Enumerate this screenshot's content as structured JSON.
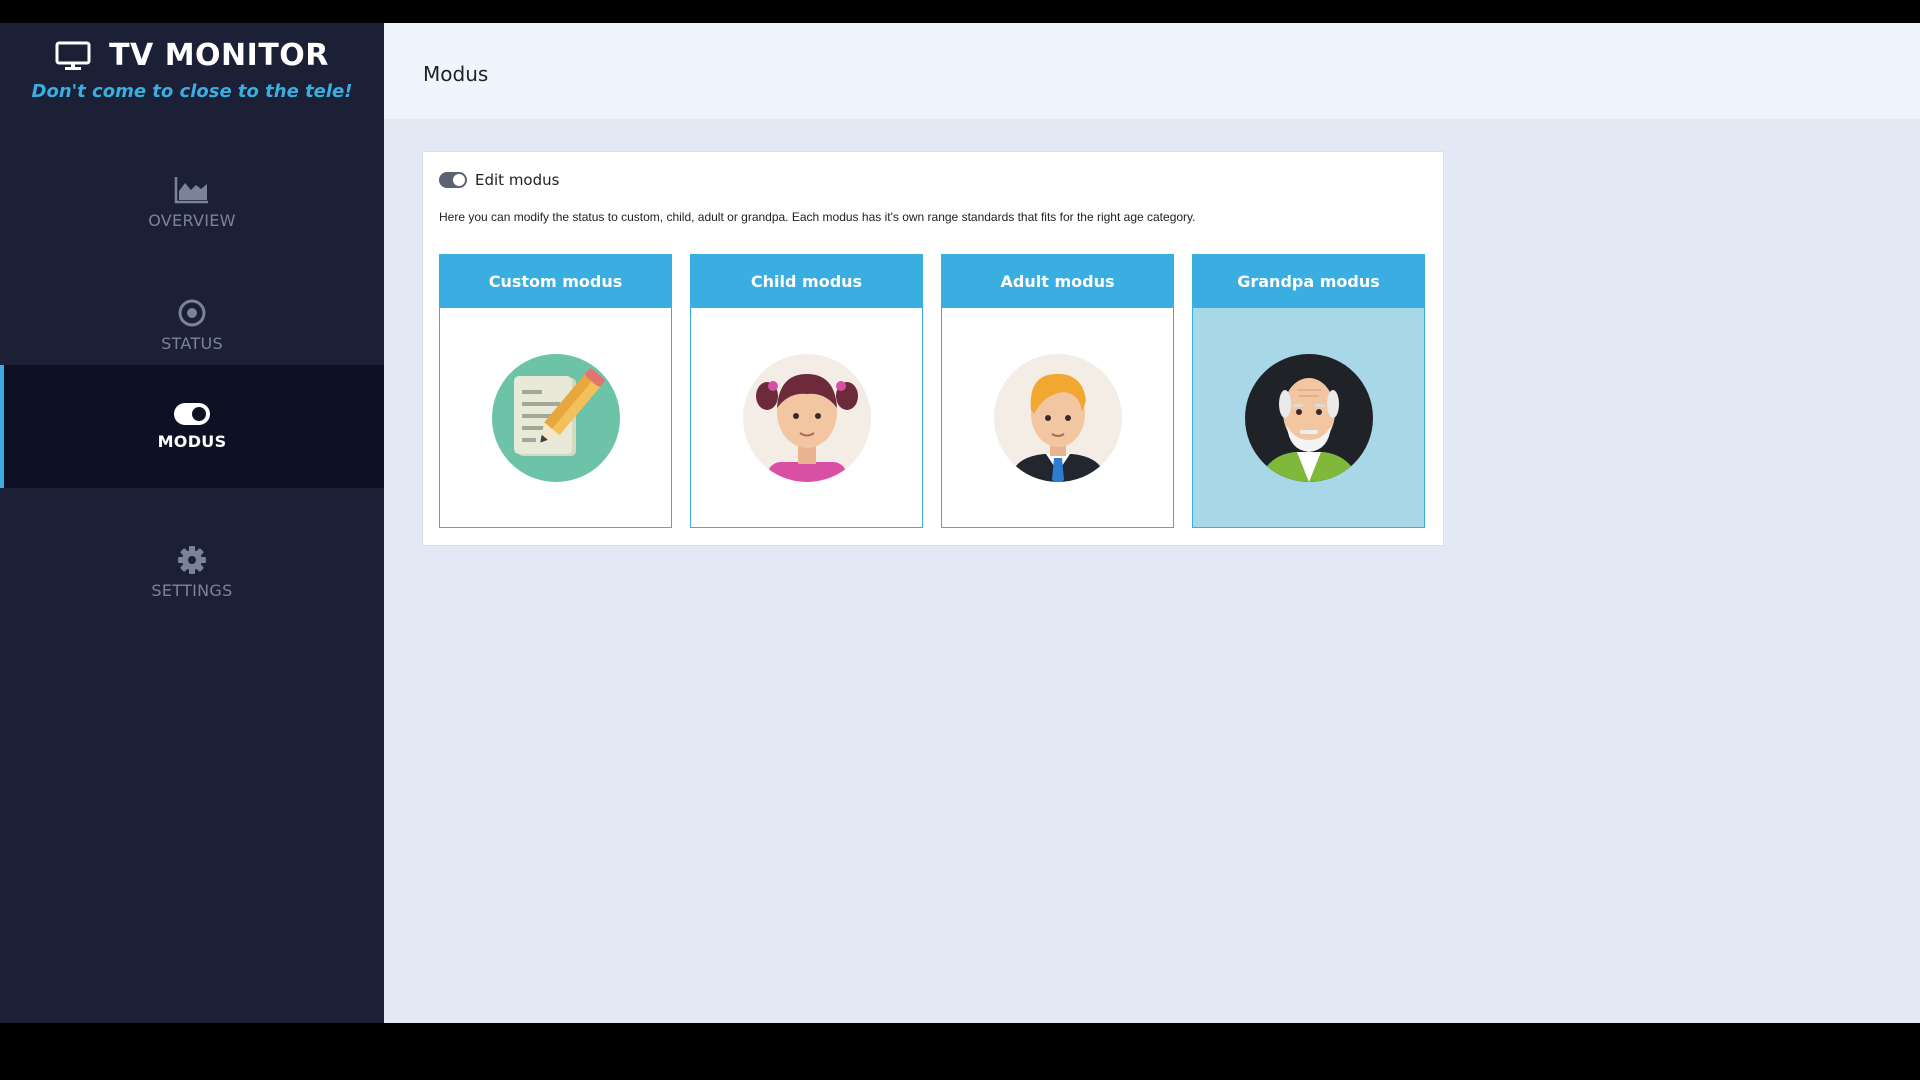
{
  "brand": {
    "title": "TV MONITOR",
    "tagline": "Don't come to close to the tele!",
    "icon": "tv-monitor-icon"
  },
  "nav": {
    "items": [
      {
        "label": "OVERVIEW",
        "icon": "area-chart-icon",
        "active": false
      },
      {
        "label": "STATUS",
        "icon": "target-icon",
        "active": false
      },
      {
        "label": "MODUS",
        "icon": "toggle-icon",
        "active": true
      },
      {
        "label": "SETTINGS",
        "icon": "gear-icon",
        "active": false
      }
    ]
  },
  "header": {
    "title": "Modus"
  },
  "panel": {
    "toggle_label": "Edit modus",
    "toggle_on": true,
    "description": "Here you can modify the status to custom, child, adult or grandpa. Each modus has it's own range standards that fits for the right age category.",
    "cards": [
      {
        "title": "Custom modus",
        "avatar": "notepad-pencil-avatar",
        "selected": false
      },
      {
        "title": "Child modus",
        "avatar": "girl-avatar",
        "selected": false
      },
      {
        "title": "Adult modus",
        "avatar": "man-suit-avatar",
        "selected": false
      },
      {
        "title": "Grandpa modus",
        "avatar": "grandpa-avatar",
        "selected": true
      }
    ]
  },
  "colors": {
    "sidebar_bg": "#1c2036",
    "sidebar_active_bg": "#0e1124",
    "accent": "#3aaee0",
    "main_bg": "#e3e9f4",
    "selected_card_bg": "#a8d8e8"
  }
}
